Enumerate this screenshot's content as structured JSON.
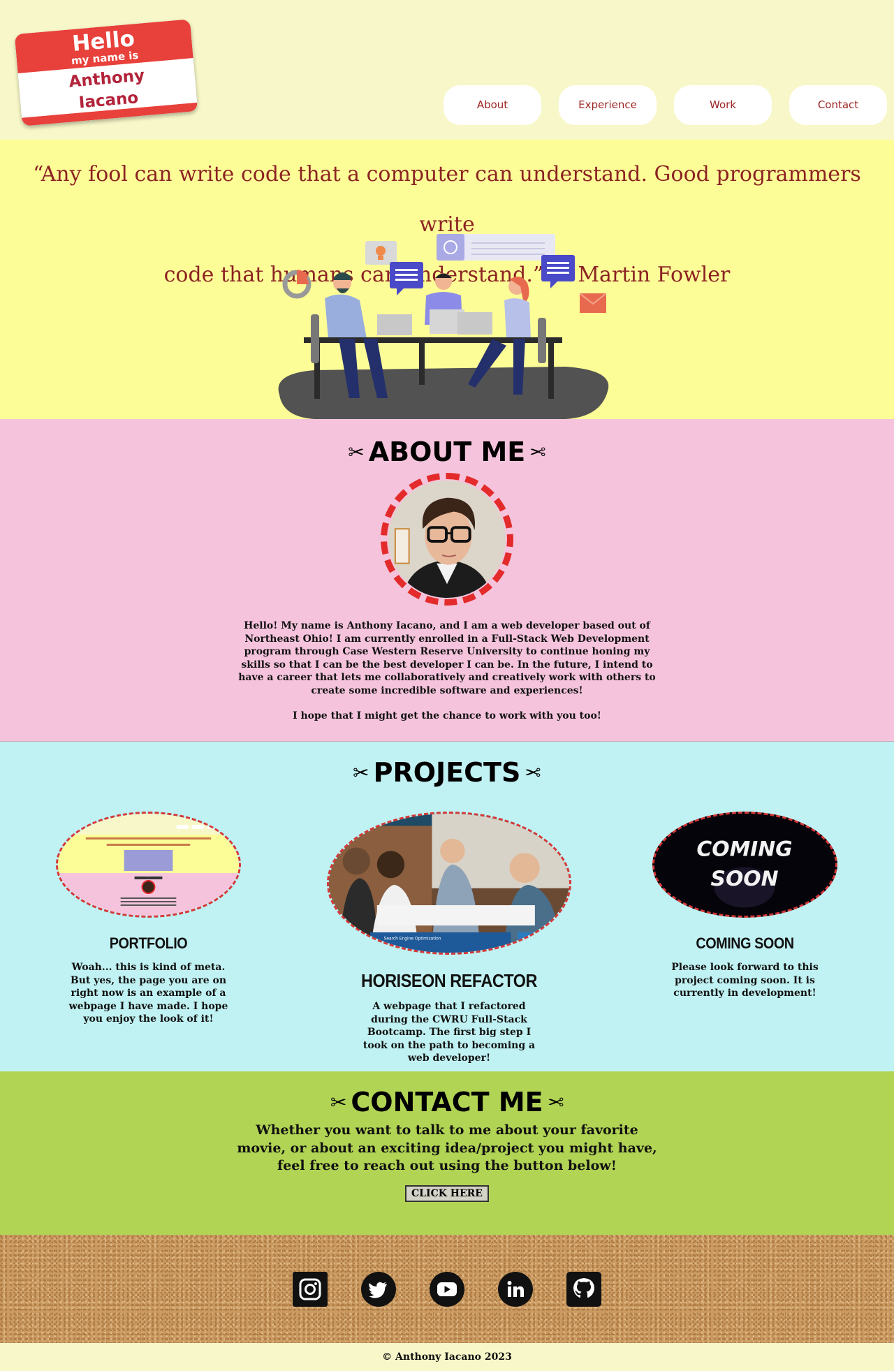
{
  "header": {
    "nametag": {
      "hello": "Hello",
      "my_name_is": "my name is",
      "first_name": "Anthony",
      "last_name": "Iacano"
    },
    "nav": [
      "About",
      "Experience",
      "Work",
      "Contact"
    ]
  },
  "hero": {
    "quote_line1": "“Any fool can write code that a computer can understand. Good programmers write",
    "quote_line2": "code that humans can understand.” — Martin Fowler"
  },
  "about": {
    "title": "ABOUT ME",
    "paragraph1": "Hello! My name is Anthony Iacano, and I am a web developer based out of Northeast Ohio! I am currently enrolled in a Full-Stack Web Development program through Case Western Reserve University to continue honing my skills so that I can be the best developer I can be. In the future, I intend to have a career that lets me collaboratively and creatively work with others to create some incredible software and experiences!",
    "paragraph2": "I hope that I might get the chance to work with you too!"
  },
  "projects": {
    "title": "PROJECTS",
    "items": [
      {
        "title": "PORTFOLIO",
        "description": "Woah... this is kind of meta. But yes, the page you are on right now is an example of a webpage I have made. I hope you enjoy the look of it!"
      },
      {
        "title": "HORISEON REFACTOR",
        "description": "A webpage that I refactored during the CWRU Full-Stack Bootcamp. The first big step I took on the path to becoming a web developer!",
        "thumb_banner": "Search Engine Optimization"
      },
      {
        "title": "COMING SOON",
        "description": "Please look forward to this project coming soon. It is currently in development!",
        "thumb_line1": "COMING",
        "thumb_line2": "SOON"
      }
    ]
  },
  "contact": {
    "title": "CONTACT ME",
    "text": "Whether you want to talk to me about your favorite movie, or about an exciting idea/project you might have, feel free to reach out using the button below!",
    "button": "CLICK HERE"
  },
  "footer": {
    "social_icons": [
      "instagram-icon",
      "twitter-icon",
      "youtube-icon",
      "linkedin-icon",
      "github-icon"
    ],
    "copyright": "© Anthony Iacano 2023"
  },
  "colors": {
    "header_bg": "#f7f7c9",
    "hero_bg": "#fdfd98",
    "about_bg": "#f5c4dc",
    "projects_bg": "#c1f2f3",
    "contact_bg": "#b2d454",
    "accent_red": "#8c2323"
  }
}
